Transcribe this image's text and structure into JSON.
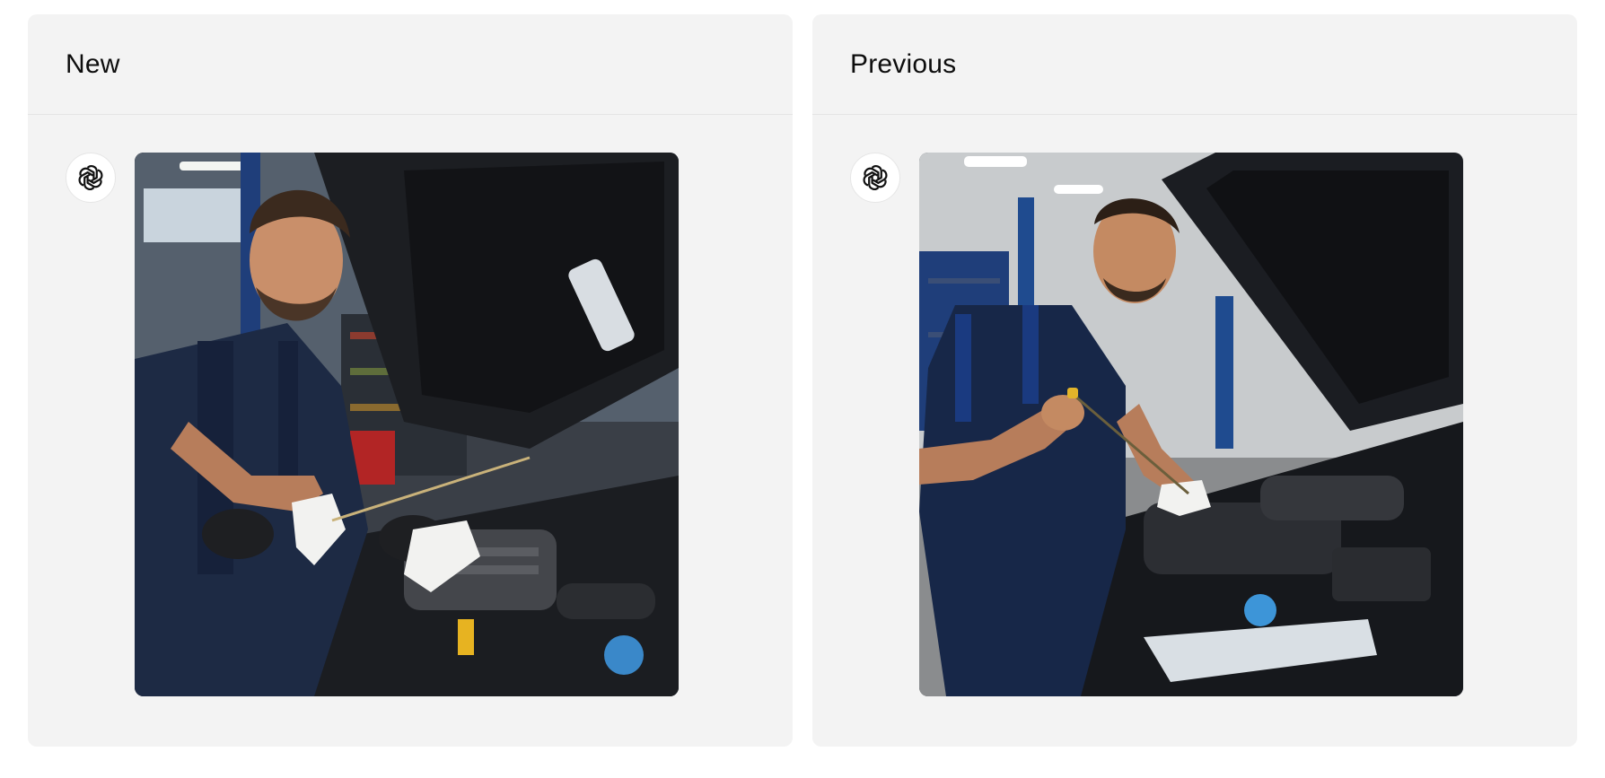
{
  "panels": [
    {
      "title": "New",
      "avatar_icon": "openai-logo-icon",
      "image_description_icon": "mechanic-checking-oil-image"
    },
    {
      "title": "Previous",
      "avatar_icon": "openai-logo-icon",
      "image_description_icon": "mechanic-checking-oil-image"
    }
  ],
  "colors": {
    "panel_bg": "#f3f3f3",
    "page_bg": "#ffffff",
    "title_text": "#0d0d0d"
  }
}
